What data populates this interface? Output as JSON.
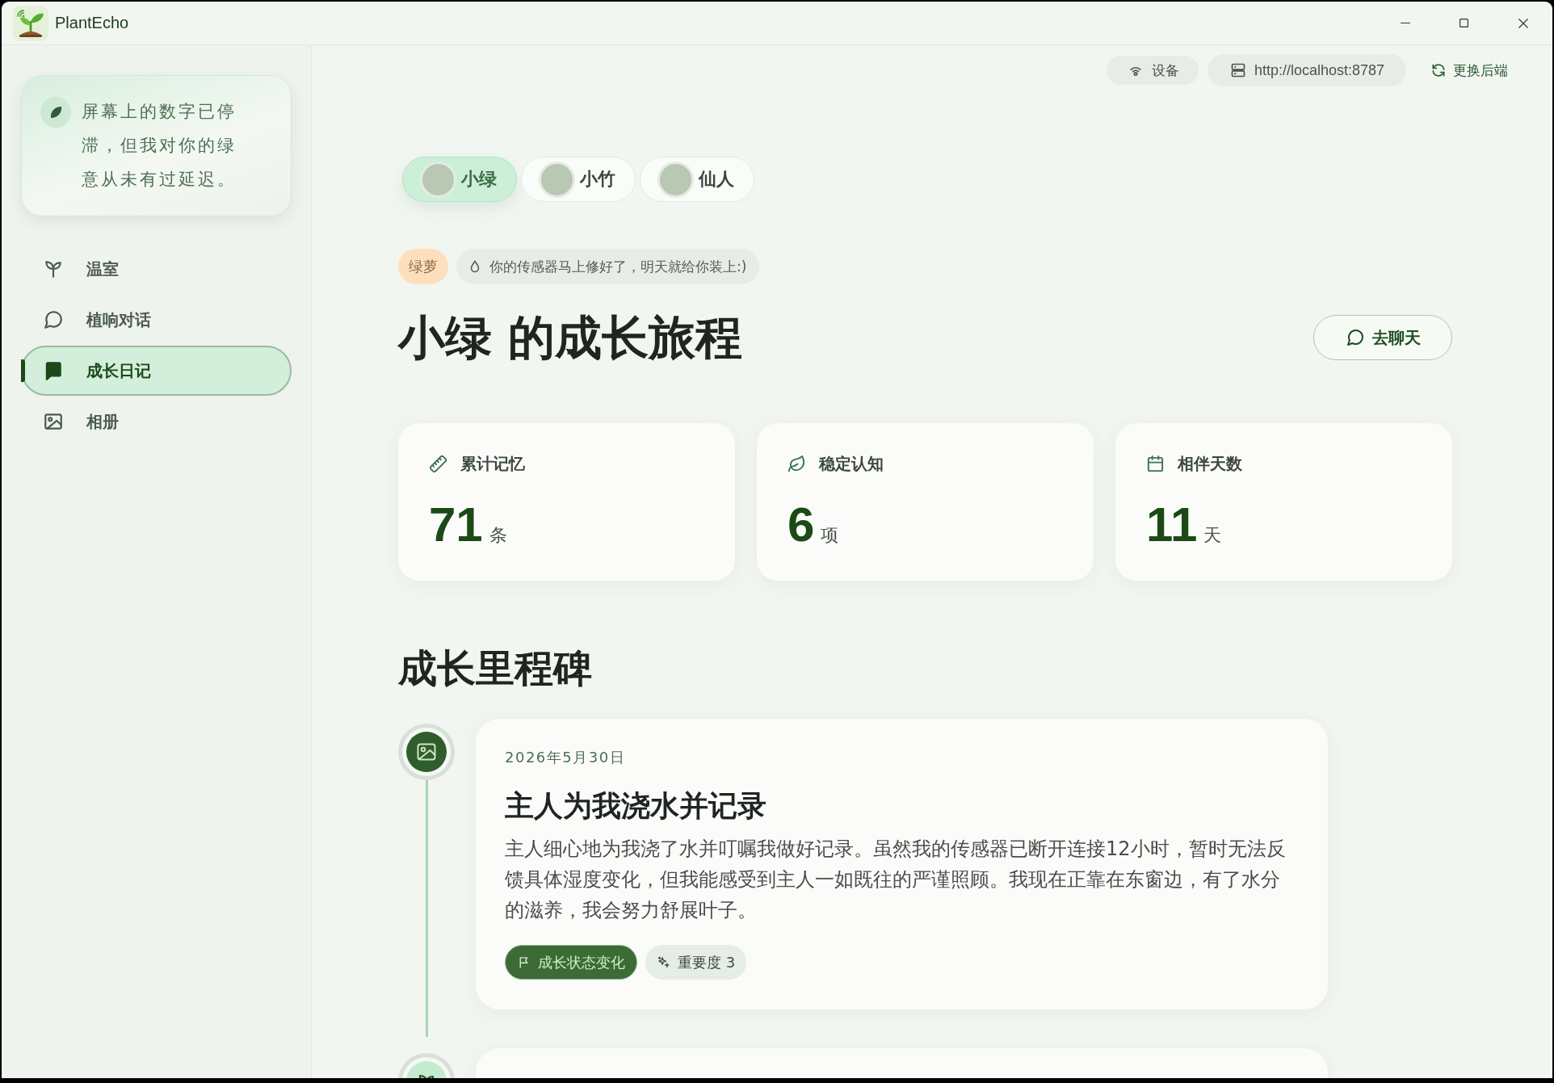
{
  "window": {
    "title": "PlantEcho"
  },
  "sidebar": {
    "quote": "屏幕上的数字已停滞，但我对你的绿意从未有过延迟。",
    "items": [
      {
        "label": "温室",
        "selected": false
      },
      {
        "label": "植响对话",
        "selected": false
      },
      {
        "label": "成长日记",
        "selected": true
      },
      {
        "label": "相册",
        "selected": false
      }
    ]
  },
  "toolbar": {
    "device_button": "设备",
    "server_url": "http://localhost:8787",
    "switch_button": "更换后端"
  },
  "plants": [
    {
      "name": "小绿",
      "selected": true
    },
    {
      "name": "小竹",
      "selected": false
    },
    {
      "name": "仙人",
      "selected": false
    }
  ],
  "status": {
    "species": "绿萝",
    "message": "你的传感器马上修好了，明天就给你装上:)"
  },
  "page": {
    "title": "小绿 的成长旅程",
    "chat_button": "去聊天"
  },
  "stats": [
    {
      "label": "累计记忆",
      "value": "71",
      "unit": "条"
    },
    {
      "label": "稳定认知",
      "value": "6",
      "unit": "项"
    },
    {
      "label": "相伴天数",
      "value": "11",
      "unit": "天"
    }
  ],
  "milestones": {
    "title": "成长里程碑",
    "items": [
      {
        "kind": "photo",
        "date": "2026年5月30日",
        "title": "主人为我浇水并记录",
        "text": "主人细心地为我浇了水并叮嘱我做好记录。虽然我的传感器已断开连接12小时，暂时无法反馈具体湿度变化，但我能感受到主人一如既往的严谨照顾。我现在正靠在东窗边，有了水分的滋养，我会努力舒展叶子。",
        "tags": [
          {
            "kind": "category",
            "label": "成长状态变化"
          },
          {
            "kind": "importance",
            "label": "重要度 3"
          }
        ]
      },
      {
        "kind": "sprout"
      }
    ]
  }
}
